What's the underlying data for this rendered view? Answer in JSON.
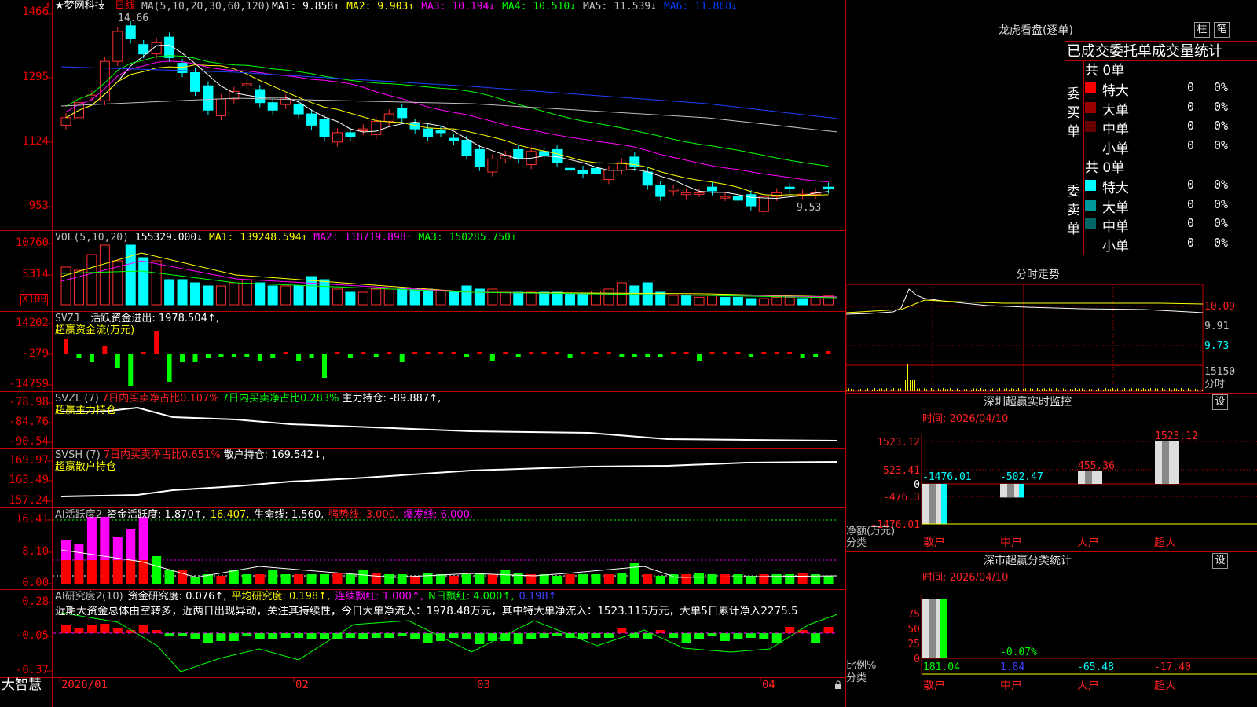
{
  "window": {
    "title": "★梦网科技",
    "period": "日线",
    "logo": "大智慧",
    "lock_icon": "lock-icon"
  },
  "price": {
    "ma_label": "MA(5,10,20,30,60,120)",
    "ma_items": [
      {
        "label": "MA1: 9.858↑",
        "color": "#ffffff"
      },
      {
        "label": "MA2: 9.903↑",
        "color": "#ffff00"
      },
      {
        "label": "MA3: 10.194↓",
        "color": "#ff00ff"
      },
      {
        "label": "MA4: 10.510↓",
        "color": "#00ff00"
      },
      {
        "label": "MA5: 11.539↓",
        "color": "#c0c0c0"
      },
      {
        "label": "MA6: 11.868↓",
        "color": "#0040ff"
      }
    ],
    "axis": [
      "1466",
      "1295",
      "1124",
      "953"
    ],
    "high_label": "14.66",
    "low_label": "9.53"
  },
  "vol": {
    "title": "VOL(5,10,20)",
    "value": "155329.000↓",
    "ma1": "MA1: 139248.594↑",
    "ma2": "MA2: 118719.898↑",
    "ma3": "MA3: 150285.750↑",
    "axis": [
      "10760",
      "5314"
    ],
    "unit": "X100"
  },
  "svzj": {
    "title": "SVZJ",
    "line1": "活跃资金进出: 1978.504↑,",
    "line2": "超赢资金流(万元)",
    "axis": [
      "14202",
      "-279",
      "-14759"
    ]
  },
  "svzl": {
    "title": "SVZL (7)",
    "a": "7日内买卖净占比0.107%",
    "b": "7日内买卖净占比0.283%",
    "c": "主力持仓: -89.887↑,",
    "line2": "超赢主力持仓",
    "axis": [
      "-78.98",
      "-84.76",
      "-90.54"
    ]
  },
  "svsh": {
    "title": "SVSH (7)",
    "a": "7日内买卖净占比0.651%",
    "c": "散户持仓: 169.542↓,",
    "line2": "超赢散户持仓",
    "axis": [
      "169.97",
      "163.49",
      "157.24"
    ]
  },
  "ai1": {
    "title": "AI活跃度2",
    "a": "资金活跃度: 1.870↑,",
    "b": "16.407,",
    "c": "生命线: 1.560,",
    "d": "强势线: 3.000,",
    "e": "爆发线: 6.000,",
    "axis": [
      "16.41",
      "8.10",
      "0.00"
    ]
  },
  "ai2": {
    "title": "AI研究度2(10)",
    "a": "资金研究度: 0.076↑,",
    "b": "平均研究度: 0.198↑,",
    "c": "连续飘红: 1.000↑,",
    "d": "N日飘红: 4.000↑,",
    "e": "0.198↑",
    "comment": "近期大资金总体由空转多，近两日出现异动，关注其持续性，今日大单净流入：1978.48万元，其中特大单净流入：1523.115万元，大单5日累计净入2275.5",
    "axis": [
      "0.28",
      "-0.05",
      "-0.37"
    ]
  },
  "dates": [
    "2026/01",
    "02",
    "03",
    "04"
  ],
  "lhb": {
    "title": "龙虎看盘(逐单)",
    "btn1": "柱",
    "btn2": "笔",
    "header": "已成交委托单成交量统计",
    "buy": {
      "label": "委买单",
      "total": "共 0单",
      "rows": [
        {
          "name": "特大",
          "v": "0",
          "p": "0%",
          "c": "#ff0000"
        },
        {
          "name": "大单",
          "v": "0",
          "p": "0%",
          "c": "#990000"
        },
        {
          "name": "中单",
          "v": "0",
          "p": "0%",
          "c": "#660000"
        },
        {
          "name": "小单",
          "v": "0",
          "p": "0%",
          "c": ""
        }
      ]
    },
    "sell": {
      "label": "委卖单",
      "total": "共 0单",
      "rows": [
        {
          "name": "特大",
          "v": "0",
          "p": "0%",
          "c": "#00ffff"
        },
        {
          "name": "大单",
          "v": "0",
          "p": "0%",
          "c": "#009999"
        },
        {
          "name": "中单",
          "v": "0",
          "p": "0%",
          "c": "#006666"
        },
        {
          "name": "小单",
          "v": "0",
          "p": "0%",
          "c": ""
        }
      ]
    }
  },
  "fenshi": {
    "title": "分时走势",
    "axis": [
      "10.09",
      "9.91",
      "9.73"
    ],
    "vol": "15150",
    "unit": "分时"
  },
  "monitor": {
    "title": "深圳超赢实时监控",
    "btn": "设",
    "time": "时间: 2026/04/10",
    "axis": [
      "1523.12",
      "523.41",
      "0",
      "-476.3",
      "-1476.01"
    ],
    "ylabel": "净额(万元)",
    "xlabel": "分类",
    "cats": [
      "散户",
      "中户",
      "大户",
      "超大"
    ],
    "values": [
      "-1476.01",
      "-502.47",
      "455.36",
      "1523.12"
    ]
  },
  "classify": {
    "title": "深市超赢分类统计",
    "btn": "设",
    "time": "时间: 2026/04/10",
    "axis": [
      "75",
      "50",
      "25",
      "0"
    ],
    "ylabel": "比例%",
    "xlabel": "分类",
    "cats": [
      "散户",
      "中户",
      "大户",
      "超大"
    ],
    "values": [
      "181.04",
      "1.84",
      "-65.48",
      "-17.40"
    ],
    "extra": "-0.07%"
  }
}
